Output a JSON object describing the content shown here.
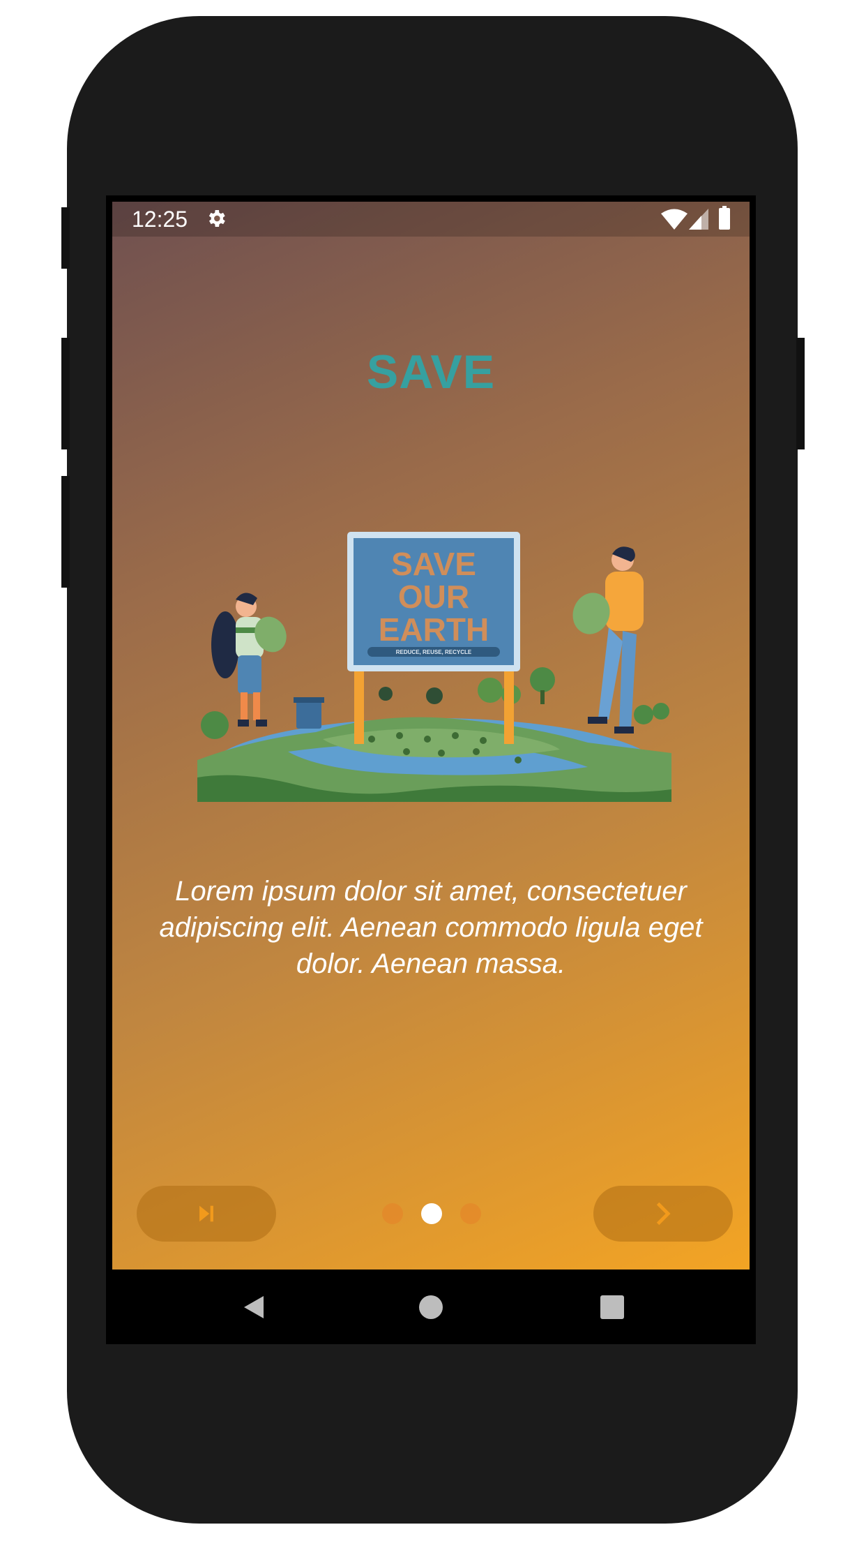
{
  "status_bar": {
    "time": "12:25",
    "icons": [
      "gear-icon",
      "wifi-icon",
      "signal-icon",
      "battery-icon"
    ]
  },
  "onboarding": {
    "title": "SAVE",
    "illustration": {
      "sign_line1": "SAVE",
      "sign_line2": "OUR",
      "sign_line3": "EARTH",
      "sign_banner": "REDUCE, REUSE, RECYCLE"
    },
    "description": "Lorem ipsum dolor sit amet, consectetuer adipiscing elit. Aenean commodo ligula eget dolor. Aenean massa.",
    "page_indicator": {
      "total": 3,
      "active": 2
    },
    "skip_button_icon": "skip-next-icon",
    "next_button_icon": "chevron-right-icon"
  },
  "navigation_bar": {
    "icons": [
      "back-icon",
      "home-icon",
      "recent-apps-icon"
    ]
  },
  "colors": {
    "title": "#36a0a0",
    "gradient_start": "#6f5050",
    "gradient_end": "#f3a424",
    "button_fill": "#b7791f",
    "button_icon": "#f29a1c",
    "dot_active": "#ffffff",
    "dot_inactive": "#e08a2c"
  }
}
